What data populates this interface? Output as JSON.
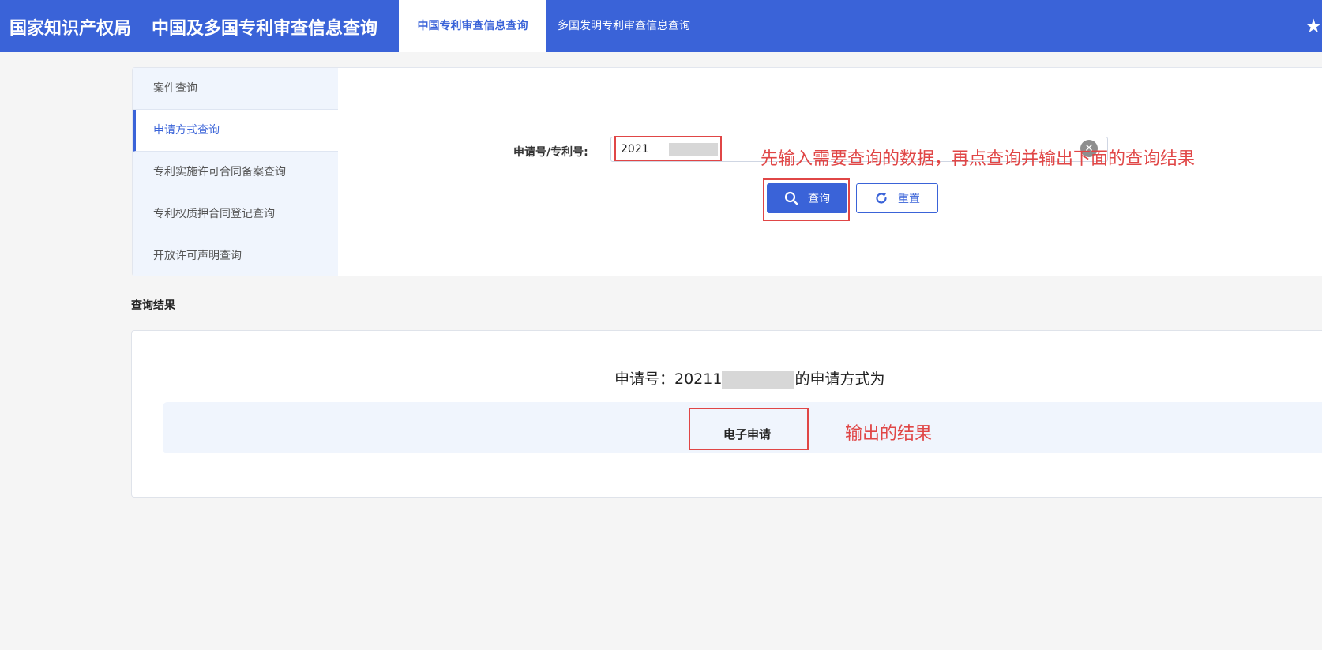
{
  "header": {
    "brand": "国家知识产权局",
    "app_title": "中国及多国专利审查信息查询",
    "tabs": [
      {
        "label": "中国专利审查信息查询",
        "active": true
      },
      {
        "label": "多国发明专利审查信息查询",
        "active": false
      }
    ],
    "star_icon": "star-icon"
  },
  "sidebar": {
    "items": [
      {
        "label": "案件查询",
        "active": false
      },
      {
        "label": "申请方式查询",
        "active": true
      },
      {
        "label": "专利实施许可合同备案查询",
        "active": false
      },
      {
        "label": "专利权质押合同登记查询",
        "active": false
      },
      {
        "label": "开放许可声明查询",
        "active": false
      }
    ]
  },
  "search": {
    "label": "申请号/专利号:",
    "value": "2021",
    "query_button": "查询",
    "reset_button": "重置"
  },
  "annotations": {
    "input_hint": "先输入需要查询的数据，再点查询并输出下面的查询结果",
    "output_hint": "输出的结果"
  },
  "results": {
    "title": "查询结果",
    "heading_prefix": "申请号：20211",
    "heading_suffix": "的申请方式为",
    "value": "电子申请"
  },
  "colors": {
    "primary": "#3a63d8",
    "annotation": "#e04646",
    "band": "#f0f5fd"
  }
}
